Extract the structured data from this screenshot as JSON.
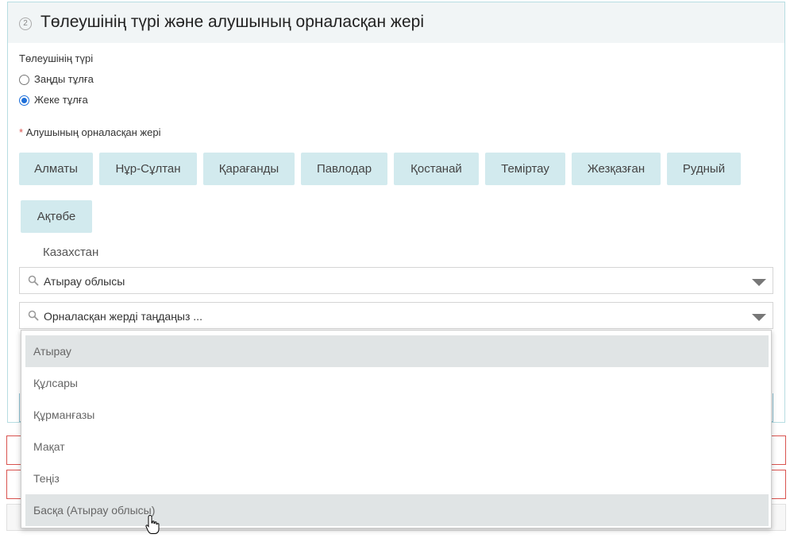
{
  "section": {
    "step_number": "2",
    "title": "Төлеушінің түрі және алушының орналасқан жері"
  },
  "payer_type": {
    "label": "Төлеушінің түрі",
    "options": [
      {
        "label": "Заңды тұлға",
        "selected": false
      },
      {
        "label": "Жеке тұлға",
        "selected": true
      }
    ]
  },
  "location": {
    "required_mark": "*",
    "label": "Алушының орналасқан жері",
    "cities": [
      "Алматы",
      "Нұр-Сұлтан",
      "Қарағанды",
      "Павлодар",
      "Қостанай",
      "Теміртау",
      "Жезқазған",
      "Рудный",
      "Ақтөбе"
    ],
    "country": "Казахстан",
    "region_select": {
      "value": "Атырау облысы"
    },
    "place_select": {
      "placeholder": "Орналасқан жерді таңдаңыз ..."
    }
  },
  "dropdown": {
    "options": [
      "Атырау",
      "Құлсары",
      "Құрманғазы",
      "Мақат",
      "Теңіз",
      "Басқа (Атырау облысы)"
    ],
    "highlighted": [
      "Атырау",
      "Басқа (Атырау облысы)"
    ]
  },
  "colors": {
    "city_button_bg": "#d2eaee",
    "panel_border": "#b7dde2",
    "error_border": "#d9534f",
    "radio_selected": "#1e6fd9"
  },
  "icons": {
    "search": "magnifier-icon",
    "dropdown": "caret-down-icon",
    "cursor": "hand-pointer-icon"
  }
}
